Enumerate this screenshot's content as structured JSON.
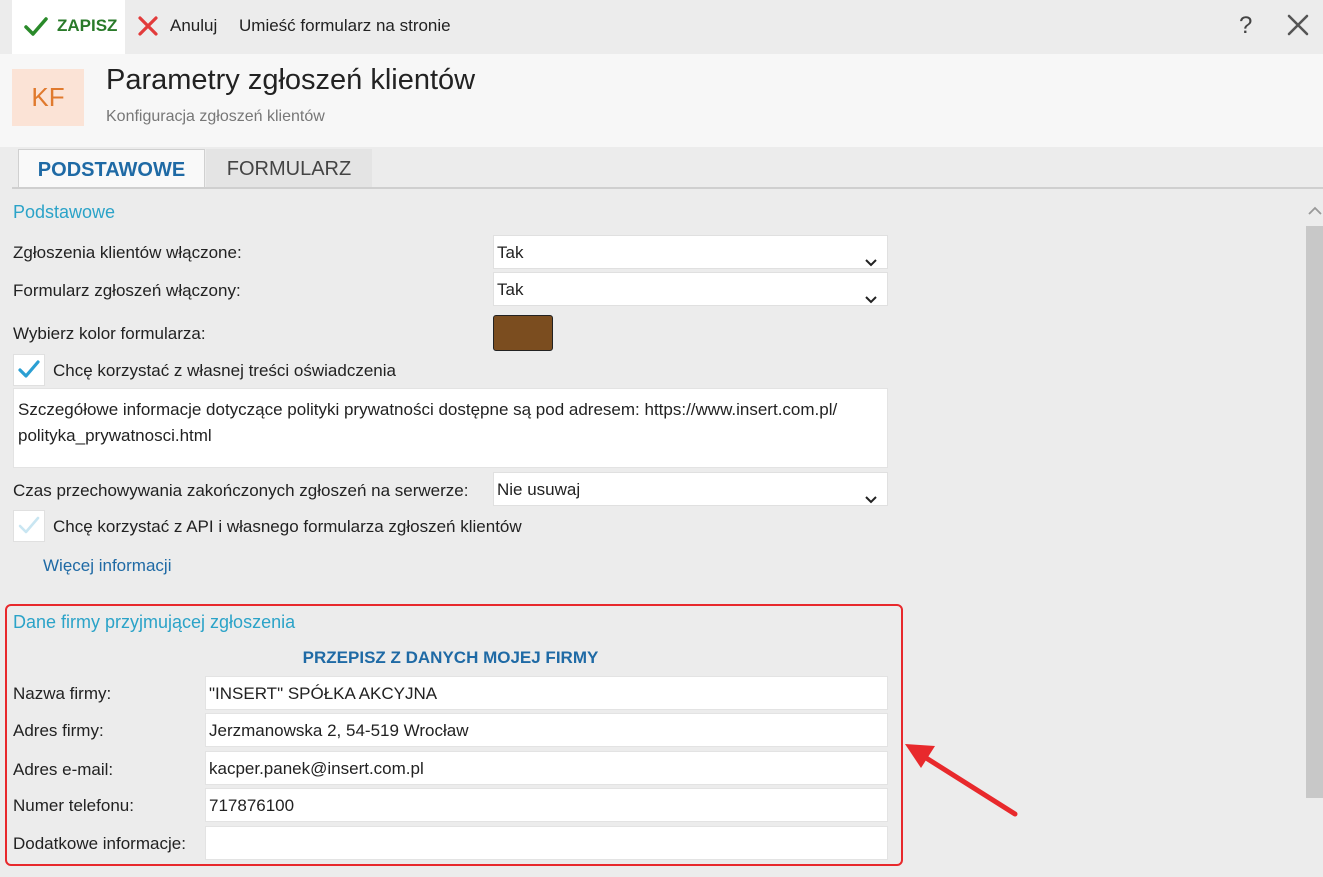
{
  "toolbar": {
    "save_label": "ZAPISZ",
    "cancel_label": "Anuluj",
    "publish_label": "Umieść formularz na stronie",
    "help_label": "?",
    "close_label": "✕"
  },
  "header": {
    "logo_text": "KF",
    "title": "Parametry zgłoszeń klientów",
    "subtitle": "Konfiguracja zgłoszeń klientów"
  },
  "tabs": [
    {
      "label": "PODSTAWOWE",
      "active": true
    },
    {
      "label": "FORMULARZ",
      "active": false
    }
  ],
  "basic": {
    "section_title": "Podstawowe",
    "enabled_label": "Zgłoszenia klientów włączone:",
    "enabled_value": "Tak",
    "form_enabled_label": "Formularz zgłoszeń włączony:",
    "form_enabled_value": "Tak",
    "color_label": "Wybierz kolor formularza:",
    "color_value": "#7b4d1f",
    "own_statement_label": "Chcę korzystać z własnej treści oświadczenia",
    "own_statement_checked": true,
    "statement_line1": "Szczegółowe informacje dotyczące polityki prywatności dostępne są pod adresem: https://www.insert.com.pl/",
    "statement_line2": "polityka_prywatnosci.html",
    "retention_label": "Czas przechowywania zakończonych zgłoszeń na serwerze:",
    "retention_value": "Nie usuwaj",
    "api_label": "Chcę korzystać z API i własnego formularza zgłoszeń klientów",
    "api_checked": false,
    "more_info_link": "Więcej informacji"
  },
  "company": {
    "section_title": "Dane firmy przyjmującej zgłoszenia",
    "copy_button": "PRZEPISZ Z DANYCH MOJEJ FIRMY",
    "fields": [
      {
        "label": "Nazwa firmy:",
        "value": "\"INSERT\" SPÓŁKA AKCYJNA"
      },
      {
        "label": "Adres firmy:",
        "value": "Jerzmanowska 2, 54-519 Wrocław"
      },
      {
        "label": "Adres e-mail:",
        "value": "kacper.panek@insert.com.pl"
      },
      {
        "label": "Numer telefonu:",
        "value": "717876100"
      },
      {
        "label": "Dodatkowe informacje:",
        "value": ""
      }
    ]
  },
  "colors": {
    "accent": "#1f6aa5",
    "section": "#2ba3c8",
    "annotation": "#e8292c"
  }
}
